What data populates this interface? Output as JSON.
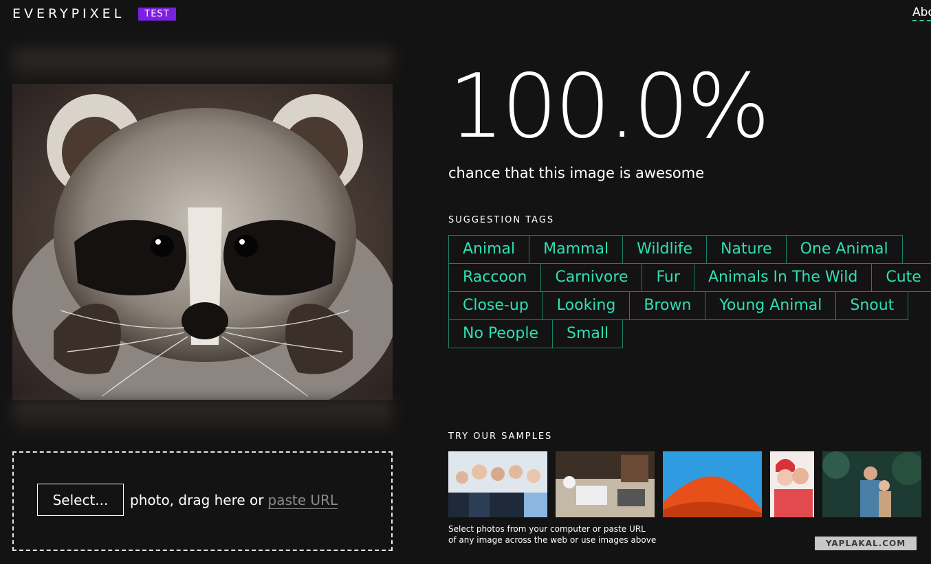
{
  "header": {
    "logo_text": "EVERYPIXEL",
    "badge": "TEST",
    "about_link": "About"
  },
  "upload": {
    "select_label": "Select...",
    "drop_text": "photo, drag here or",
    "paste_url": "paste URL"
  },
  "result": {
    "score": "100.0%",
    "caption": "chance that this image is awesome"
  },
  "tags": {
    "title": "SUGGESTION TAGS",
    "rows": [
      [
        "Animal",
        "Mammal",
        "Wildlife",
        "Nature",
        "One Animal"
      ],
      [
        "Raccoon",
        "Carnivore",
        "Fur",
        "Animals In The Wild",
        "Cute"
      ],
      [
        "Close-up",
        "Looking",
        "Brown",
        "Young Animal",
        "Snout"
      ],
      [
        "No People",
        "Small"
      ]
    ]
  },
  "samples": {
    "title": "TRY OUR SAMPLES",
    "note_line1": "Select photos from your computer or paste URL",
    "note_line2": "of any image across the web or use images above"
  },
  "watermark": "YAPLAKAL.COM",
  "colors": {
    "background": "#131313",
    "accent_tag": "#2ee0b4",
    "tag_border": "#19826c",
    "badge": "#7b1fe0"
  }
}
